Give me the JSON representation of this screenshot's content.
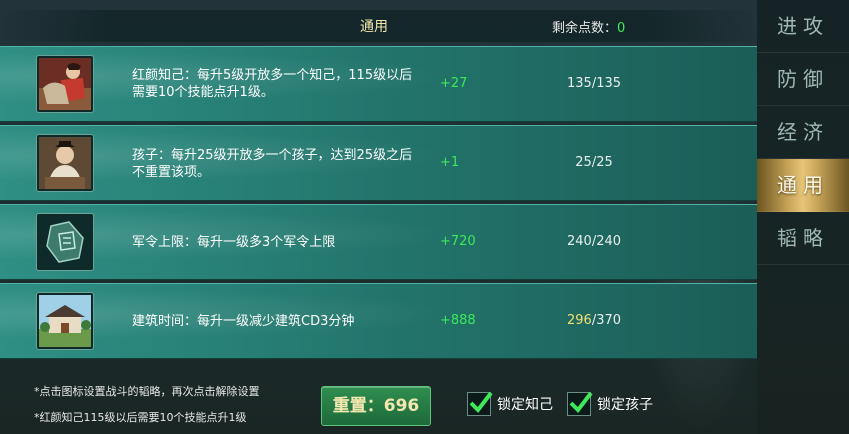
{
  "header": {
    "title": "通用",
    "remain_label": "剩余点数：",
    "remain_value": "0"
  },
  "rows": [
    {
      "icon": "portrait-rider-icon",
      "desc": "红颜知己：每升5级开放多一个知己，115级以后需要10个技能点升1级。",
      "bonus": "+27",
      "current": "135",
      "max": "/135"
    },
    {
      "icon": "portrait-child-icon",
      "desc": "孩子：每升25级开放多一个孩子，达到25级之后不重置该项。",
      "bonus": "+1",
      "current": "25",
      "max": "/25"
    },
    {
      "icon": "jade-token-icon",
      "desc": "军令上限：每升一级多3个军令上限",
      "bonus": "+720",
      "current": "240",
      "max": "/240"
    },
    {
      "icon": "building-icon",
      "desc": "建筑时间：每升一级减少建筑CD3分钟",
      "bonus": "+888",
      "current": "296",
      "max": "/370"
    }
  ],
  "sidebar": {
    "tabs": [
      "进攻",
      "防御",
      "经济",
      "通用",
      "韬略"
    ],
    "active_index": 3
  },
  "footer": {
    "note1": "*点击图标设置战斗的韬略，再次点击解除设置",
    "note2": "*红颜知己115级以后需要10个技能点升1级",
    "reset_label": "重置：696",
    "lock_confidant": "锁定知己",
    "lock_child": "锁定孩子"
  },
  "colors": {
    "accent_green": "#3ee85a",
    "gold": "#e6c478",
    "row_teal": "#2f8f84"
  }
}
